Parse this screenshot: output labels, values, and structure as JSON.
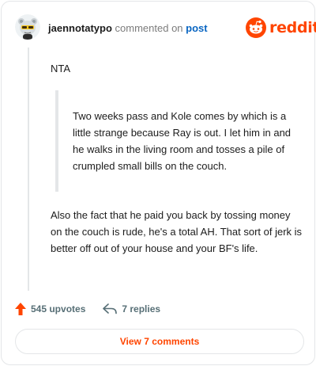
{
  "header": {
    "username": "jaennotatypo",
    "action_text": "commented on",
    "post_link": "post",
    "brand": "reddit"
  },
  "comment": {
    "line1": "NTA",
    "quote": "Two weeks pass and Kole comes by which is a little strange because Ray is out. I let him in and he walks in the living room and tosses a pile of crumpled small bills on the couch.",
    "paragraph2": "Also the fact that he paid you back by tossing money on the couch is rude, he's a total AH. That sort of jerk is better off out of your house and your BF's life."
  },
  "footer": {
    "upvotes": "545 upvotes",
    "replies": "7 replies",
    "view_comments": "View 7 comments"
  },
  "colors": {
    "accent": "#ff4500",
    "link": "#0a66c2",
    "muted": "#576f76",
    "border": "#e4e6e8"
  },
  "icons": {
    "avatar": "snoo-avatar",
    "brand": "reddit-logo-icon",
    "upvote": "upvote-arrow-icon",
    "reply": "reply-arrow-icon"
  }
}
